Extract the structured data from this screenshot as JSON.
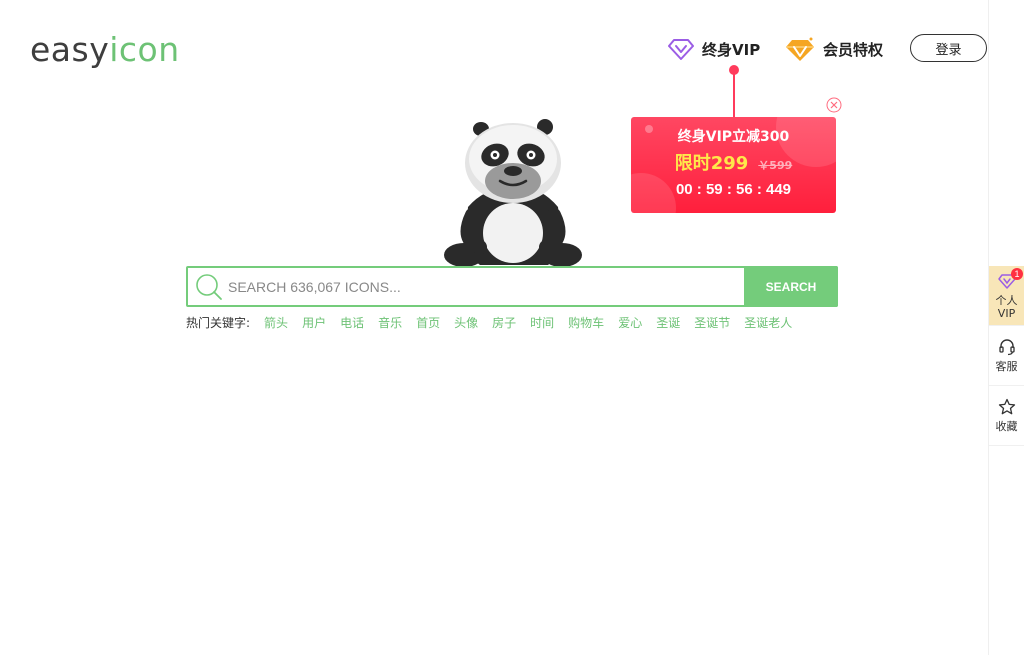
{
  "logo": {
    "part1": "easy",
    "part2": "icon"
  },
  "header": {
    "vip_lifetime_label": "终身VIP",
    "vip_privilege_label": "会员特权",
    "login_label": "登录"
  },
  "promo": {
    "title": "终身VIP立减300",
    "price": "限时299",
    "old_price": "￥599",
    "countdown": "00 : 59 : 56 : 449"
  },
  "search": {
    "placeholder": "SEARCH 636,067 ICONS...",
    "button_label": "SEARCH"
  },
  "hot_keywords": {
    "label": "热门关键字:",
    "items": [
      "箭头",
      "用户",
      "电话",
      "音乐",
      "首页",
      "头像",
      "房子",
      "时间",
      "购物车",
      "爱心",
      "圣诞",
      "圣诞节",
      "圣诞老人"
    ]
  },
  "sidebar": {
    "vip": {
      "line1": "个人",
      "line2": "VIP",
      "badge": "1"
    },
    "service": {
      "label": "客服"
    },
    "favorite": {
      "label": "收藏"
    }
  },
  "colors": {
    "brand_green": "#74cc7b",
    "promo_red": "#ff2a45",
    "price_yellow": "#ffe84a",
    "vip_gold": "#f8e6b8"
  },
  "icons": {
    "vip_lifetime": "purple-diamond-icon",
    "vip_privilege": "gold-diamond-icon",
    "close": "close-circle-icon",
    "search": "magnifier-icon",
    "service": "headset-icon",
    "favorite": "star-icon"
  }
}
